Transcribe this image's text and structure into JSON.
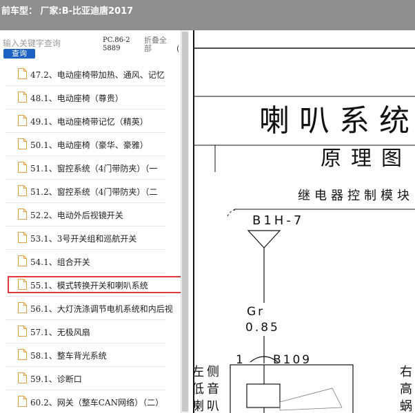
{
  "titlebar": {
    "title": "前车型： 厂家:B-比亚迪唐2017"
  },
  "search": {
    "placeholder": "输入关键字查询",
    "button_label": "查询"
  },
  "toolbar": {
    "pc_code": "PC.86-25889",
    "fold_all_label": "折叠全部",
    "paren": "("
  },
  "list": {
    "items": [
      {
        "label": "47.2、电动座椅带加热、通风、记忆"
      },
      {
        "label": "48.1、电动座椅（尊贵）"
      },
      {
        "label": "49.1、电动座椅带记忆（精英）"
      },
      {
        "label": "50.1、电动座椅（豪华、豪雅）"
      },
      {
        "label": "51.1、窗控系统（4门带防夹）（一"
      },
      {
        "label": "51.2、窗控系统（4门带防夹）（二"
      },
      {
        "label": "52.2、电动外后视镜开关"
      },
      {
        "label": "53.1、3号开关组和巡航开关"
      },
      {
        "label": "54.1、组合开关"
      },
      {
        "label": "55.1、模式转换开关和喇叭系统"
      },
      {
        "label": "56.1、大灯洗涤调节电机系统和内后视"
      },
      {
        "label": "57.1、无极风扇"
      },
      {
        "label": "58.1、整车背光系统"
      },
      {
        "label": "59.1、诊断口"
      },
      {
        "label": "60.2、网关（整车CAN网络）（二）"
      }
    ],
    "selected_index": 9
  },
  "document": {
    "heading": "喇叭系统",
    "subheading": "原理图",
    "relay_label": "继电器控制模块",
    "connector_top": "B1H-7",
    "wire_color": "Gr",
    "wire_gauge": "0.85",
    "pin_number": "1",
    "connector_bottom": "B109",
    "left_side_text": [
      "左侧",
      "低音",
      "喇叭"
    ],
    "right_side_text": [
      "右",
      "高",
      "蜗"
    ]
  },
  "colors": {
    "titlebar_bg": "#8e8e8e",
    "search_button_bg": "#1b62c4",
    "selection_border": "#e03b3b"
  }
}
